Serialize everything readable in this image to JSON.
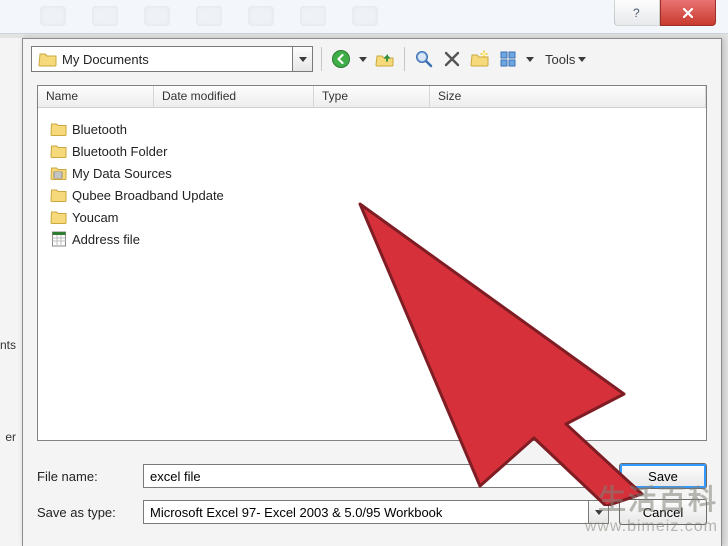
{
  "titlebar": {
    "help_tooltip": "Help",
    "close_tooltip": "Close"
  },
  "toolbar": {
    "location": "My Documents",
    "tools_label": "Tools"
  },
  "icons": {
    "back": "back-icon",
    "up": "up-one-level-icon",
    "search": "search-icon",
    "delete": "delete-icon",
    "new_folder": "new-folder-icon",
    "views": "views-icon"
  },
  "columns": {
    "name": "Name",
    "date": "Date modified",
    "type": "Type",
    "size": "Size"
  },
  "files": [
    {
      "kind": "folder",
      "label": "Bluetooth"
    },
    {
      "kind": "folder",
      "label": "Bluetooth Folder"
    },
    {
      "kind": "datasource",
      "label": "My Data Sources"
    },
    {
      "kind": "folder",
      "label": "Qubee Broadband Update"
    },
    {
      "kind": "folder",
      "label": "Youcam"
    },
    {
      "kind": "excel",
      "label": "Address file"
    }
  ],
  "left_hints": {
    "a": "nts",
    "b": "er"
  },
  "form": {
    "filename_label": "File name:",
    "filename_value": "excel file",
    "savetype_label": "Save as type:",
    "savetype_value": "Microsoft Excel 97- Excel 2003 & 5.0/95 Workbook",
    "save_btn": "Save",
    "cancel_btn": "Cancel"
  },
  "watermark": {
    "line1": "生活百科",
    "line2": "www.bimeiz.com"
  }
}
